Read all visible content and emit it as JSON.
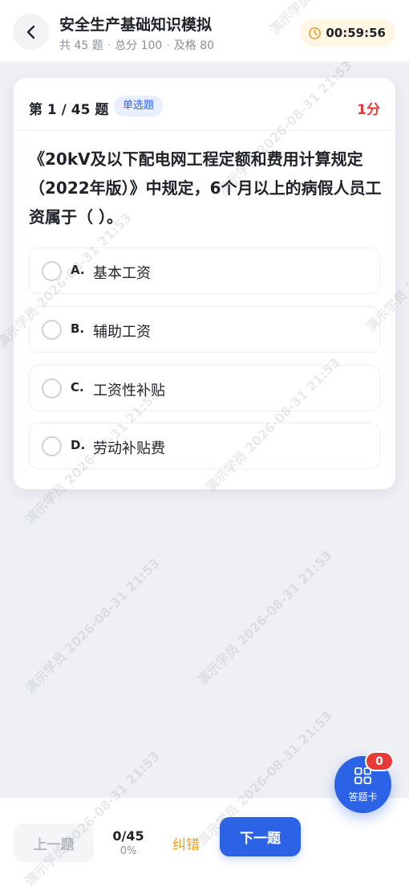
{
  "header": {
    "title": "安全生产基础知识模拟",
    "meta": {
      "total": "共 45 题",
      "score": "总分 100",
      "pass": "及格 80"
    },
    "timer": "00:59:56"
  },
  "question": {
    "number": "第 1 / 45 题",
    "type": "单选题",
    "score": "1分",
    "text": "《20kV及以下配电网工程定额和费用计算规定（2022年版）》中规定，6个月以上的病假人员工资属于（ ）。",
    "options": [
      {
        "letter": "A.",
        "text": "基本工资"
      },
      {
        "letter": "B.",
        "text": "辅助工资"
      },
      {
        "letter": "C.",
        "text": "工资性补贴"
      },
      {
        "letter": "D.",
        "text": "劳动补贴费"
      }
    ]
  },
  "answer_card": {
    "label": "答题卡",
    "badge": "0"
  },
  "footer": {
    "prev_label": "上一题",
    "progress_count": "0/45",
    "progress_percent": "0%",
    "report_label": "纠错",
    "next_label": "下一题"
  },
  "watermark": "演示学员 2026-08-31 21:53",
  "colors": {
    "accent": "#2b62e6",
    "score_red": "#e83a3a",
    "report_orange": "#f0a020",
    "timer_bg": "#fff7e6"
  }
}
